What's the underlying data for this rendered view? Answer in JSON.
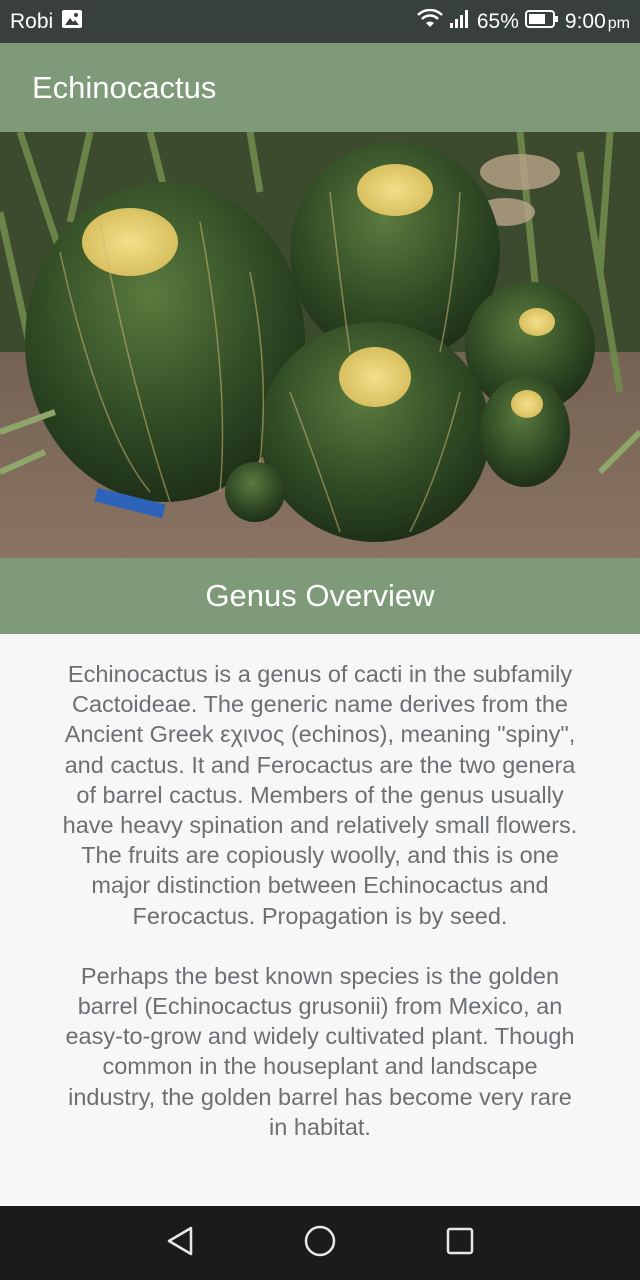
{
  "status_bar": {
    "carrier": "Robi",
    "battery": "65%",
    "time": "9:00",
    "ampm": "pm",
    "icons": [
      "image-icon",
      "wifi-icon",
      "signal-icon",
      "battery-icon"
    ]
  },
  "app_bar": {
    "title": "Echinocactus"
  },
  "hero": {
    "image_subject": "golden barrel cactus cluster"
  },
  "section": {
    "title": "Genus Overview"
  },
  "content": {
    "paragraph_1": "Echinocactus is a genus of cacti in the subfamily Cactoideae. The generic name derives from the Ancient Greek εχινος (echinos), meaning \"spiny\", and cactus. It and Ferocactus are the two genera of barrel cactus. Members of the genus usually have heavy spination and relatively small flowers. The fruits are copiously woolly, and this is one major distinction between Echinocactus and Ferocactus. Propagation is by seed.",
    "paragraph_2": "Perhaps the best known species is the golden barrel (Echinocactus grusonii) from Mexico, an easy-to-grow and widely cultivated plant. Though common in the houseplant and landscape industry, the golden barrel has become very rare in habitat."
  },
  "nav_bar": {
    "icons": [
      "back-icon",
      "home-icon",
      "recents-icon"
    ]
  },
  "colors": {
    "accent": "#7f9a78",
    "status_bar": "#37403a",
    "nav_bar": "#1b1b1b",
    "body_text": "#6c6f73"
  }
}
